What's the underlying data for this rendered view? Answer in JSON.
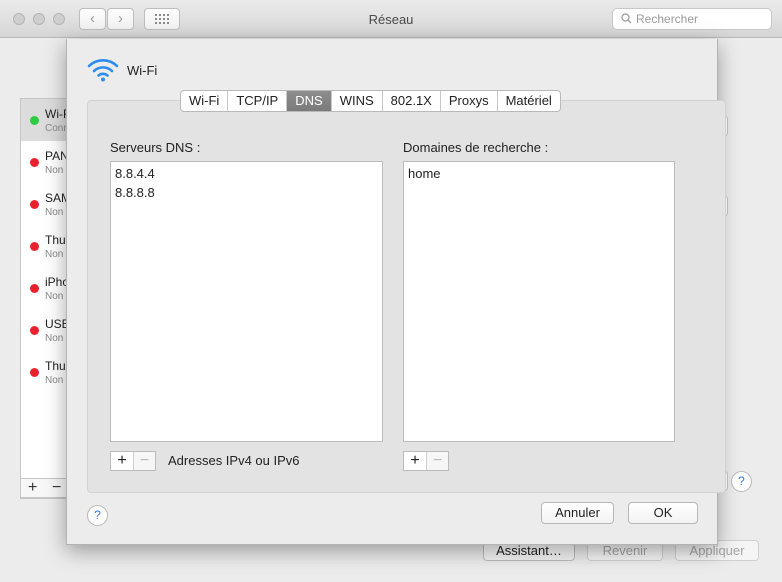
{
  "window": {
    "title": "Réseau"
  },
  "search": {
    "placeholder": "Rechercher"
  },
  "icons": {
    "back": "chevron-left-icon",
    "forward": "chevron-right-icon",
    "grid": "grid-icon",
    "search": "magnifier-icon",
    "wifi": "wifi-icon",
    "help": "question-mark-icon"
  },
  "colors": {
    "status_connected": "#2ecc40",
    "status_disconnected": "#e8222c",
    "accent": "#2d7ef0",
    "tab_active": "#808080"
  },
  "services": [
    {
      "name": "Wi-Fi",
      "status": "Connecté",
      "state": "connected"
    },
    {
      "name": "PAN",
      "status": "Non",
      "state": "disconnected"
    },
    {
      "name": "SAMSUNG",
      "status": "Non",
      "state": "disconnected"
    },
    {
      "name": "Thunderbolt",
      "status": "Non",
      "state": "disconnected"
    },
    {
      "name": "iPhone",
      "status": "Non",
      "state": "disconnected"
    },
    {
      "name": "USB",
      "status": "Non",
      "state": "disconnected"
    },
    {
      "name": "Thunderbolt",
      "status": "Non",
      "state": "disconnected"
    }
  ],
  "background_buttons": {
    "assistant": "Assistant…",
    "revert": "Revenir",
    "apply": "Appliquer"
  },
  "sheet": {
    "title": "Wi-Fi",
    "tabs": [
      {
        "label": "Wi-Fi",
        "active": false
      },
      {
        "label": "TCP/IP",
        "active": false
      },
      {
        "label": "DNS",
        "active": true
      },
      {
        "label": "WINS",
        "active": false
      },
      {
        "label": "802.1X",
        "active": false
      },
      {
        "label": "Proxys",
        "active": false
      },
      {
        "label": "Matériel",
        "active": false
      }
    ],
    "dns": {
      "servers_label": "Serveurs DNS :",
      "servers": [
        "8.8.4.4",
        "8.8.8.8"
      ],
      "servers_hint": "Adresses IPv4 ou IPv6",
      "search_label": "Domaines de recherche :",
      "search_domains": [
        "home"
      ]
    },
    "add_symbol": "+",
    "remove_symbol": "−",
    "help_symbol": "?",
    "cancel_label": "Annuler",
    "ok_label": "OK"
  }
}
